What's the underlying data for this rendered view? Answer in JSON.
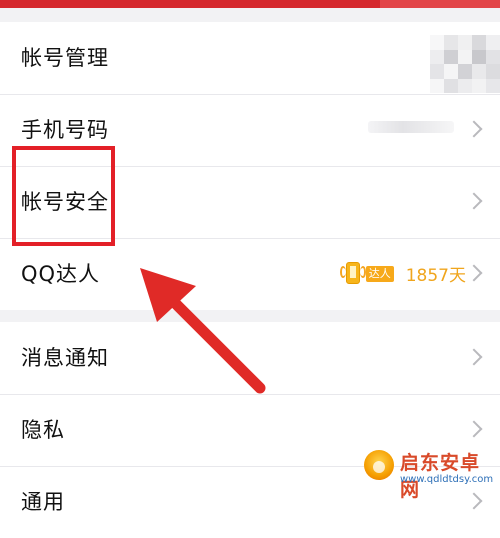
{
  "settings": {
    "groups": [
      [
        {
          "label": "帐号管理",
          "accessory": "avatar"
        },
        {
          "label": "手机号码",
          "accessory": "phone"
        },
        {
          "label": "帐号安全",
          "accessory": "chevron"
        },
        {
          "label": "QQ达人",
          "accessory": "vip"
        }
      ],
      [
        {
          "label": "消息通知",
          "accessory": "chevron"
        },
        {
          "label": "隐私",
          "accessory": "chevron"
        },
        {
          "label": "通用",
          "accessory": "chevron"
        }
      ]
    ]
  },
  "qq_master": {
    "badge_text": "达人",
    "days": "1857天"
  },
  "annotation": {
    "highlight_color": "#e32027",
    "arrow_color": "#e02a27"
  },
  "watermark": {
    "title": "启东安卓网",
    "url": "www.qdldtdsy.com"
  },
  "colors": {
    "topbar": "#d5282d",
    "accent_orange": "#f0a51d"
  },
  "icons": {
    "chevron": "chevron-right-icon",
    "avatar": "avatar-image",
    "master": "qq-master-icon"
  }
}
